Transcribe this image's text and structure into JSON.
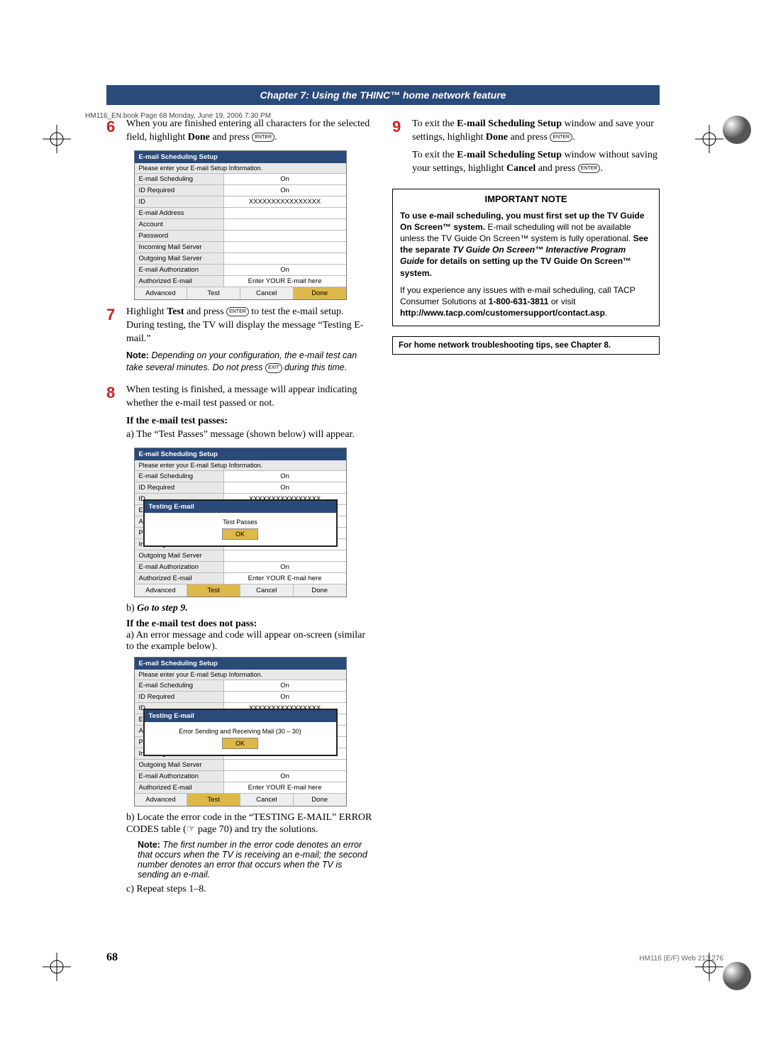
{
  "header_line": "HM116_EN.book  Page 68  Monday, June 19, 2006  7:30 PM",
  "chapter_bar": "Chapter 7: Using the THINC™ home network feature",
  "steps": {
    "s6": {
      "num": "6",
      "text_a": "When you are finished entering all characters for the selected field, highlight ",
      "bold_a": "Done",
      "text_b": " and press ",
      "icon_text": "ENTER",
      "text_c": "."
    },
    "s7": {
      "num": "7",
      "text_a": "Highlight ",
      "bold_a": "Test",
      "text_b": " and press ",
      "icon_text": "ENTER",
      "text_c": " to test the e-mail setup.",
      "text_d": "During testing, the TV will display the message “Testing E-mail.”",
      "note": "Depending on your configuration, the e-mail test can take several minutes. Do not press ",
      "exit_icon": "EXIT",
      "note_tail": " during this time."
    },
    "s8": {
      "num": "8",
      "text": "When testing is finished, a message will appear indicating whether the e-mail test passed or not.",
      "pass_head": "If the e-mail test passes:",
      "pass_a": "a) The “Test Passes” message (shown below) will appear.",
      "pass_b_label": "b)",
      "pass_b_italic": "Go to step 9.",
      "fail_head": "If the e-mail test does not pass:",
      "fail_a": "a) An error message and code will appear on-screen (similar to the example below).",
      "fail_b": "b) Locate the error code in the “TESTING E-MAIL” ERROR CODES table (☞ page 70) and try the solutions.",
      "fail_note": "The first number in the error code denotes an error that occurs when the TV is receiving an e-mail; the second number denotes an error that occurs when the TV is sending an e-mail.",
      "fail_c": "c) Repeat steps 1–8."
    },
    "s9": {
      "num": "9",
      "text_a": "To exit the ",
      "bold_a": "E-mail Scheduling Setup",
      "text_b": " window and save your settings, highlight ",
      "bold_b": "Done",
      "text_c": " and press ",
      "icon_text": "ENTER",
      "text_d": ".",
      "para2_a": "To exit the ",
      "para2_bold_a": "E-mail Scheduling Setup",
      "para2_b": " window without saving your settings, highlight ",
      "para2_bold_b": "Cancel",
      "para2_c": " and press ",
      "para2_d": "."
    }
  },
  "setup": {
    "title": "E-mail Scheduling Setup",
    "desc": "Please enter your E-mail Setup Information.",
    "rows": {
      "scheduling": {
        "label": "E-mail Scheduling",
        "value": "On"
      },
      "idreq": {
        "label": "ID Required",
        "value": "On"
      },
      "id": {
        "label": "ID",
        "value": "XXXXXXXXXXXXXXXX"
      },
      "email": {
        "label": "E-mail Address",
        "value": ""
      },
      "account": {
        "label": "Account",
        "value": ""
      },
      "password": {
        "label": "Password",
        "value": ""
      },
      "incoming": {
        "label": "Incoming Mail Server",
        "value": ""
      },
      "outgoing": {
        "label": "Outgoing Mail Server",
        "value": ""
      },
      "auth": {
        "label": "E-mail Authorization",
        "value": "On"
      },
      "authmail": {
        "label": "Authorized E-mail",
        "value": "Enter YOUR E-mail here"
      }
    },
    "buttons": {
      "advanced": "Advanced",
      "test": "Test",
      "cancel": "Cancel",
      "done": "Done"
    }
  },
  "overlay_pass": {
    "title": "Testing E-mail",
    "msg": "Test Passes",
    "ok": "OK"
  },
  "overlay_fail": {
    "title": "Testing E-mail",
    "msg": "Error Sending and Receiving Mail (30 – 30)",
    "ok": "OK"
  },
  "important": {
    "title": "IMPORTANT NOTE",
    "p1_a": "To use e-mail scheduling, you must first set up the TV Guide On Screen™ system.",
    "p1_b": " E-mail scheduling will not be available unless the TV Guide On Screen™ system is fully operational. ",
    "p1_c": "See the separate ",
    "p1_d": "TV Guide On Screen™ Interactive Program Guide",
    "p1_e": " for details on setting up the TV Guide On Screen™ system.",
    "p2_a": "If you experience any issues with e-mail scheduling, call TACP Consumer Solutions at ",
    "p2_b": "1-800-631-3811",
    "p2_c": " or visit ",
    "p2_d": "http://www.tacp.com/customersupport/contact.asp",
    "p2_e": "."
  },
  "tip_box": "For home network troubleshooting tips, see Chapter 8.",
  "page_num": "68",
  "footer_small": "HM116 (E/F) Web 213:276"
}
